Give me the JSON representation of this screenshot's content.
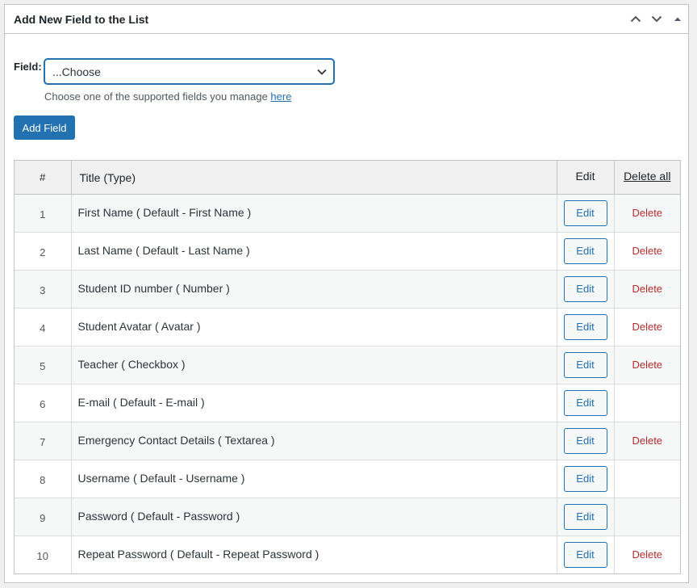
{
  "panel": {
    "title": "Add New Field to the List"
  },
  "form": {
    "field_label": "Field:",
    "select_value": "...Choose",
    "help_text": "Choose one of the supported fields you manage ",
    "help_link": "here",
    "add_button": "Add Field"
  },
  "table": {
    "headers": {
      "num": "#",
      "title": "Title (Type)",
      "edit": "Edit",
      "delete_all": "Delete all"
    },
    "rows": [
      {
        "num": "1",
        "title": "First Name ( Default - First Name )",
        "edit": "Edit",
        "delete": "Delete"
      },
      {
        "num": "2",
        "title": "Last Name ( Default - Last Name )",
        "edit": "Edit",
        "delete": "Delete"
      },
      {
        "num": "3",
        "title": "Student ID number ( Number )",
        "edit": "Edit",
        "delete": "Delete"
      },
      {
        "num": "4",
        "title": "Student Avatar ( Avatar )",
        "edit": "Edit",
        "delete": "Delete"
      },
      {
        "num": "5",
        "title": "Teacher ( Checkbox )",
        "edit": "Edit",
        "delete": "Delete"
      },
      {
        "num": "6",
        "title": "E-mail ( Default - E-mail )",
        "edit": "Edit",
        "delete": ""
      },
      {
        "num": "7",
        "title": "Emergency Contact Details ( Textarea )",
        "edit": "Edit",
        "delete": "Delete"
      },
      {
        "num": "8",
        "title": "Username ( Default - Username )",
        "edit": "Edit",
        "delete": ""
      },
      {
        "num": "9",
        "title": "Password ( Default - Password )",
        "edit": "Edit",
        "delete": ""
      },
      {
        "num": "10",
        "title": "Repeat Password ( Default - Repeat Password )",
        "edit": "Edit",
        "delete": "Delete"
      }
    ]
  },
  "icons": {
    "move_up": "chevron-up-icon",
    "move_down": "chevron-down-icon",
    "toggle": "caret-up-icon",
    "select_arrow": "chevron-down-icon"
  },
  "colors": {
    "accent": "#2271b1",
    "delete": "#b32d2e",
    "border": "#c3c4c7"
  }
}
